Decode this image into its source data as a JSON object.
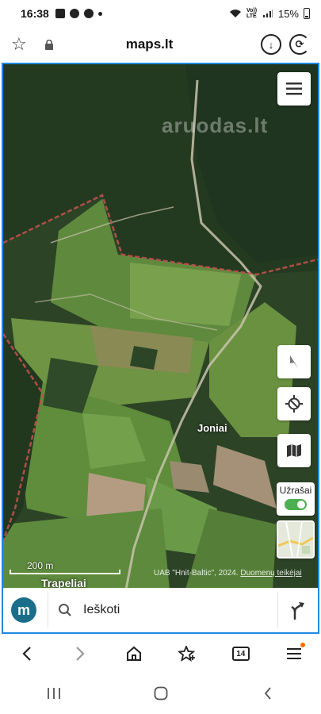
{
  "status_bar": {
    "time": "16:38",
    "network": "Vo)) LTE",
    "battery_percent": "15%",
    "icons": [
      "gallery-icon",
      "alert-icon",
      "facebook-icon",
      "dot-icon",
      "wifi-icon",
      "signal-icon",
      "battery-icon"
    ]
  },
  "browser": {
    "url": "maps.lt",
    "bookmark_icon": "star-icon",
    "lock_icon": "lock-icon",
    "download_icon": "download-icon",
    "reload_icon": "reload-icon"
  },
  "map": {
    "watermark": "aruodas.lt",
    "place_label": "Joniai",
    "place_label_2": "Trapeliai",
    "scale_label": "200 m",
    "attribution_prefix": "UAB \"Hnit-Baltic\", 2024.",
    "attribution_link": "Duomenų teikėjai",
    "notes_label": "Užrašai",
    "notes_toggle_on": true,
    "buttons": [
      "menu-icon",
      "compass-icon",
      "locate-icon",
      "map-layers-icon"
    ]
  },
  "search": {
    "logo_letter": "m",
    "placeholder": "Ieškoti",
    "directions_icon": "directions-icon"
  },
  "bottom_nav": {
    "tab_count": "14",
    "items": [
      "back-icon",
      "forward-icon",
      "home-icon",
      "bookmarks-icon",
      "tabs-icon",
      "menu-icon"
    ]
  },
  "system_nav": {
    "items": [
      "recents-icon",
      "home-button-icon",
      "back-icon"
    ]
  },
  "colors": {
    "accent_blue": "#1e88e5",
    "logo_teal": "#1a6e8a",
    "toggle_green": "#4caf50",
    "boundary_red": "#c0504d",
    "notif_orange": "#ff6d00"
  }
}
